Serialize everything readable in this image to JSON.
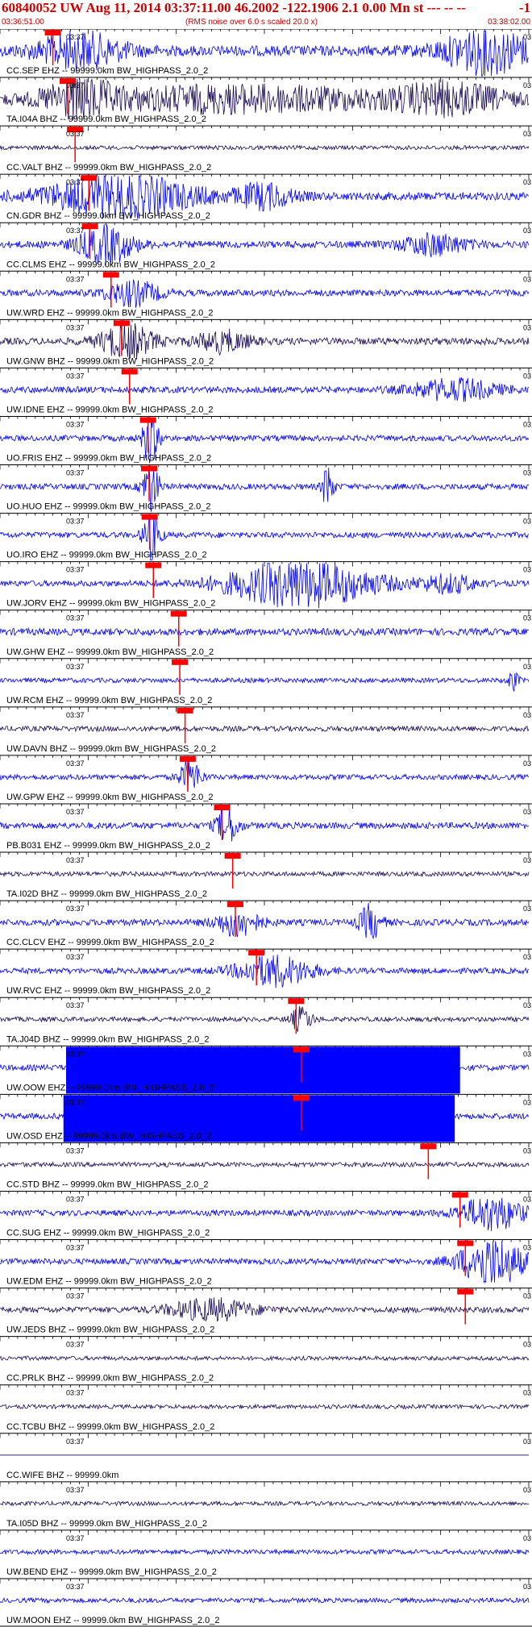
{
  "header": {
    "title": "60840052 UW Aug 11, 2014 03:37:11.00   46.2002 -122.1906  2.1 0.00 Mn st --- -- --",
    "right_mark": "-1",
    "start_time": "03:36:51.00",
    "rms_note": "(RMS noise over 6.0 s scaled 20.0 x)",
    "end_time": "03:38:02.00"
  },
  "colors": {
    "header_text": "#cc0000",
    "trace_blue": "#0000ff",
    "trace_dark": "#1a0a55",
    "pick_red": "#ff0000",
    "divider": "#000000"
  },
  "chart_data": {
    "type": "line",
    "start_time": "03:36:51.00",
    "end_time": "03:38:02.00",
    "minute_marker_left": "03:37",
    "minute_marker_right": "03",
    "traces": [
      {
        "label": "CC.SEP EHZ -- 99999.0km BW_HIGHPASS_2.0_2",
        "pick": 0.1,
        "color": "blue",
        "amp": 0.9,
        "bursts": [
          [
            0.15,
            0.08,
            1.0
          ],
          [
            0.92,
            0.08,
            1.3
          ]
        ]
      },
      {
        "label": "TA.I04A BHZ -- 99999.0km BW_HIGHPASS_2.0_2",
        "pick": 0.128,
        "color": "dark",
        "amp": 0.8,
        "bursts": [
          [
            0.15,
            0.06,
            1.0
          ],
          [
            0.45,
            0.3,
            0.7
          ],
          [
            0.85,
            0.1,
            0.8
          ]
        ]
      },
      {
        "label": "CC.VALT BHZ -- 99999.0km BW_HIGHPASS_2.0_2",
        "pick": 0.142,
        "color": "dark",
        "amp": 0.35,
        "bursts": []
      },
      {
        "label": "CN.GDR BHZ -- 99999.0km BW_HIGHPASS_2.0_2",
        "pick": 0.168,
        "color": "blue",
        "amp": 0.7,
        "bursts": [
          [
            0.23,
            0.14,
            1.2
          ],
          [
            0.5,
            0.05,
            0.7
          ]
        ]
      },
      {
        "label": "CC.CLMS EHZ -- 99999.0km BW_HIGHPASS_2.0_2",
        "pick": 0.17,
        "color": "blue",
        "amp": 0.6,
        "bursts": [
          [
            0.2,
            0.05,
            1.1
          ],
          [
            0.82,
            0.06,
            0.6
          ]
        ]
      },
      {
        "label": "UW.WRD EHZ -- 99999.0km BW_HIGHPASS_2.0_2",
        "pick": 0.21,
        "color": "blue",
        "amp": 0.55,
        "bursts": [
          [
            0.25,
            0.05,
            0.7
          ]
        ]
      },
      {
        "label": "UW.GNW BHZ -- 99999.0km BW_HIGHPASS_2.0_2",
        "pick": 0.23,
        "color": "dark",
        "amp": 0.6,
        "bursts": [
          [
            0.24,
            0.05,
            1.0
          ],
          [
            0.42,
            0.05,
            0.6
          ]
        ]
      },
      {
        "label": "UW.IDNE EHZ -- 99999.0km BW_HIGHPASS_2.0_2",
        "pick": 0.245,
        "color": "blue",
        "amp": 0.55,
        "bursts": [
          [
            0.86,
            0.08,
            0.6
          ]
        ]
      },
      {
        "label": "UO.FRIS EHZ -- 99999.0km BW_HIGHPASS_2.0_2",
        "pick": 0.28,
        "color": "blue",
        "amp": 0.5,
        "bursts": [
          [
            0.285,
            0.015,
            1.6
          ]
        ]
      },
      {
        "label": "UO.HUO EHZ -- 99999.0km BW_HIGHPASS_2.0_2",
        "pick": 0.282,
        "color": "blue",
        "amp": 0.5,
        "bursts": [
          [
            0.285,
            0.015,
            1.6
          ],
          [
            0.62,
            0.01,
            1.4
          ]
        ]
      },
      {
        "label": "UO.IRO EHZ -- 99999.0km BW_HIGHPASS_2.0_2",
        "pick": 0.283,
        "color": "blue",
        "amp": 0.5,
        "bursts": [
          [
            0.287,
            0.015,
            1.7
          ]
        ]
      },
      {
        "label": "UW.JORV EHZ -- 99999.0km BW_HIGHPASS_2.0_2",
        "pick": 0.29,
        "color": "blue",
        "amp": 0.5,
        "bursts": [
          [
            0.57,
            0.14,
            1.4
          ],
          [
            0.85,
            0.05,
            0.5
          ]
        ]
      },
      {
        "label": "UW.GHW EHZ -- 99999.0km BW_HIGHPASS_2.0_2",
        "pick": 0.338,
        "color": "blue",
        "amp": 0.6,
        "bursts": []
      },
      {
        "label": "UW.RCM EHZ -- 99999.0km BW_HIGHPASS_2.0_2",
        "pick": 0.34,
        "color": "blue",
        "amp": 0.4,
        "bursts": [
          [
            0.97,
            0.01,
            0.6
          ]
        ]
      },
      {
        "label": "UW.DAVN BHZ -- 99999.0km BW_HIGHPASS_2.0_2",
        "pick": 0.35,
        "color": "dark",
        "amp": 0.45,
        "bursts": []
      },
      {
        "label": "UW.GPW EHZ -- 99999.0km BW_HIGHPASS_2.0_2",
        "pick": 0.355,
        "color": "blue",
        "amp": 0.45,
        "bursts": [
          [
            0.36,
            0.02,
            1.0
          ]
        ]
      },
      {
        "label": "PB.B031 EHZ -- 99999.0km BW_HIGHPASS_2.0_2",
        "pick": 0.42,
        "color": "blue",
        "amp": 0.55,
        "bursts": [
          [
            0.43,
            0.02,
            1.1
          ]
        ]
      },
      {
        "label": "TA.I02D BHZ -- 99999.0km BW_HIGHPASS_2.0_2",
        "pick": 0.44,
        "color": "dark",
        "amp": 0.4,
        "bursts": []
      },
      {
        "label": "CC.CLCV EHZ -- 99999.0km BW_HIGHPASS_2.0_2",
        "pick": 0.445,
        "color": "blue",
        "amp": 0.55,
        "bursts": [
          [
            0.45,
            0.04,
            0.8
          ],
          [
            0.7,
            0.02,
            1.0
          ]
        ]
      },
      {
        "label": "UW.RVC EHZ -- 99999.0km BW_HIGHPASS_2.0_2",
        "pick": 0.485,
        "color": "blue",
        "amp": 0.5,
        "bursts": [
          [
            0.52,
            0.07,
            0.9
          ]
        ]
      },
      {
        "label": "TA.J04D BHZ -- 99999.0km BW_HIGHPASS_2.0_2",
        "pick": 0.56,
        "color": "dark",
        "amp": 0.4,
        "bursts": [
          [
            0.57,
            0.02,
            0.7
          ]
        ]
      },
      {
        "label": "UW.OOW EHZ -- 99999.0km BW_HIGHPASS_2.0_2",
        "pick": 0.57,
        "color": "blue",
        "amp": 0.5,
        "bursts": [],
        "saturated": [
          0.125,
          0.87
        ]
      },
      {
        "label": "UW.OSD EHZ -- 99999.0km BW_HIGHPASS_2.0_2",
        "pick": 0.57,
        "color": "blue",
        "amp": 0.5,
        "bursts": [],
        "saturated": [
          0.12,
          0.86
        ]
      },
      {
        "label": "CC.STD BHZ -- 99999.0km BW_HIGHPASS_2.0_2",
        "pick": 0.81,
        "color": "dark",
        "amp": 0.4,
        "bursts": []
      },
      {
        "label": "CC.SUG EHZ -- 99999.0km BW_HIGHPASS_2.0_2",
        "pick": 0.87,
        "color": "blue",
        "amp": 0.5,
        "bursts": [
          [
            0.93,
            0.06,
            1.0
          ]
        ]
      },
      {
        "label": "UW.EDM EHZ -- 99999.0km BW_HIGHPASS_2.0_2",
        "pick": 0.88,
        "color": "blue",
        "amp": 0.5,
        "bursts": [
          [
            0.93,
            0.06,
            1.5
          ]
        ]
      },
      {
        "label": "UW.JEDS BHZ -- 99999.0km BW_HIGHPASS_2.0_2",
        "pick": 0.88,
        "color": "dark",
        "amp": 0.5,
        "bursts": [
          [
            0.4,
            0.08,
            0.6
          ]
        ]
      },
      {
        "label": "CC.PRLK BHZ -- 99999.0km BW_HIGHPASS_2.0_2",
        "pick": null,
        "color": "dark",
        "amp": 0.35,
        "bursts": []
      },
      {
        "label": "CC.TCBU BHZ -- 99999.0km BW_HIGHPASS_2.0_2",
        "pick": null,
        "color": "dark",
        "amp": 0.35,
        "bursts": []
      },
      {
        "label": "CC.WIFE BHZ -- 99999.0km",
        "pick": null,
        "color": "dark",
        "amp": 0.0,
        "bursts": []
      },
      {
        "label": "TA.I05D BHZ -- 99999.0km BW_HIGHPASS_2.0_2",
        "pick": null,
        "color": "dark",
        "amp": 0.35,
        "bursts": []
      },
      {
        "label": "UW.BEND EHZ -- 99999.0km BW_HIGHPASS_2.0_2",
        "pick": null,
        "color": "blue",
        "amp": 0.4,
        "bursts": []
      },
      {
        "label": "UW.MOON EHZ -- 99999.0km BW_HIGHPASS_2.0_2",
        "pick": null,
        "color": "blue",
        "amp": 0.4,
        "bursts": []
      }
    ]
  }
}
